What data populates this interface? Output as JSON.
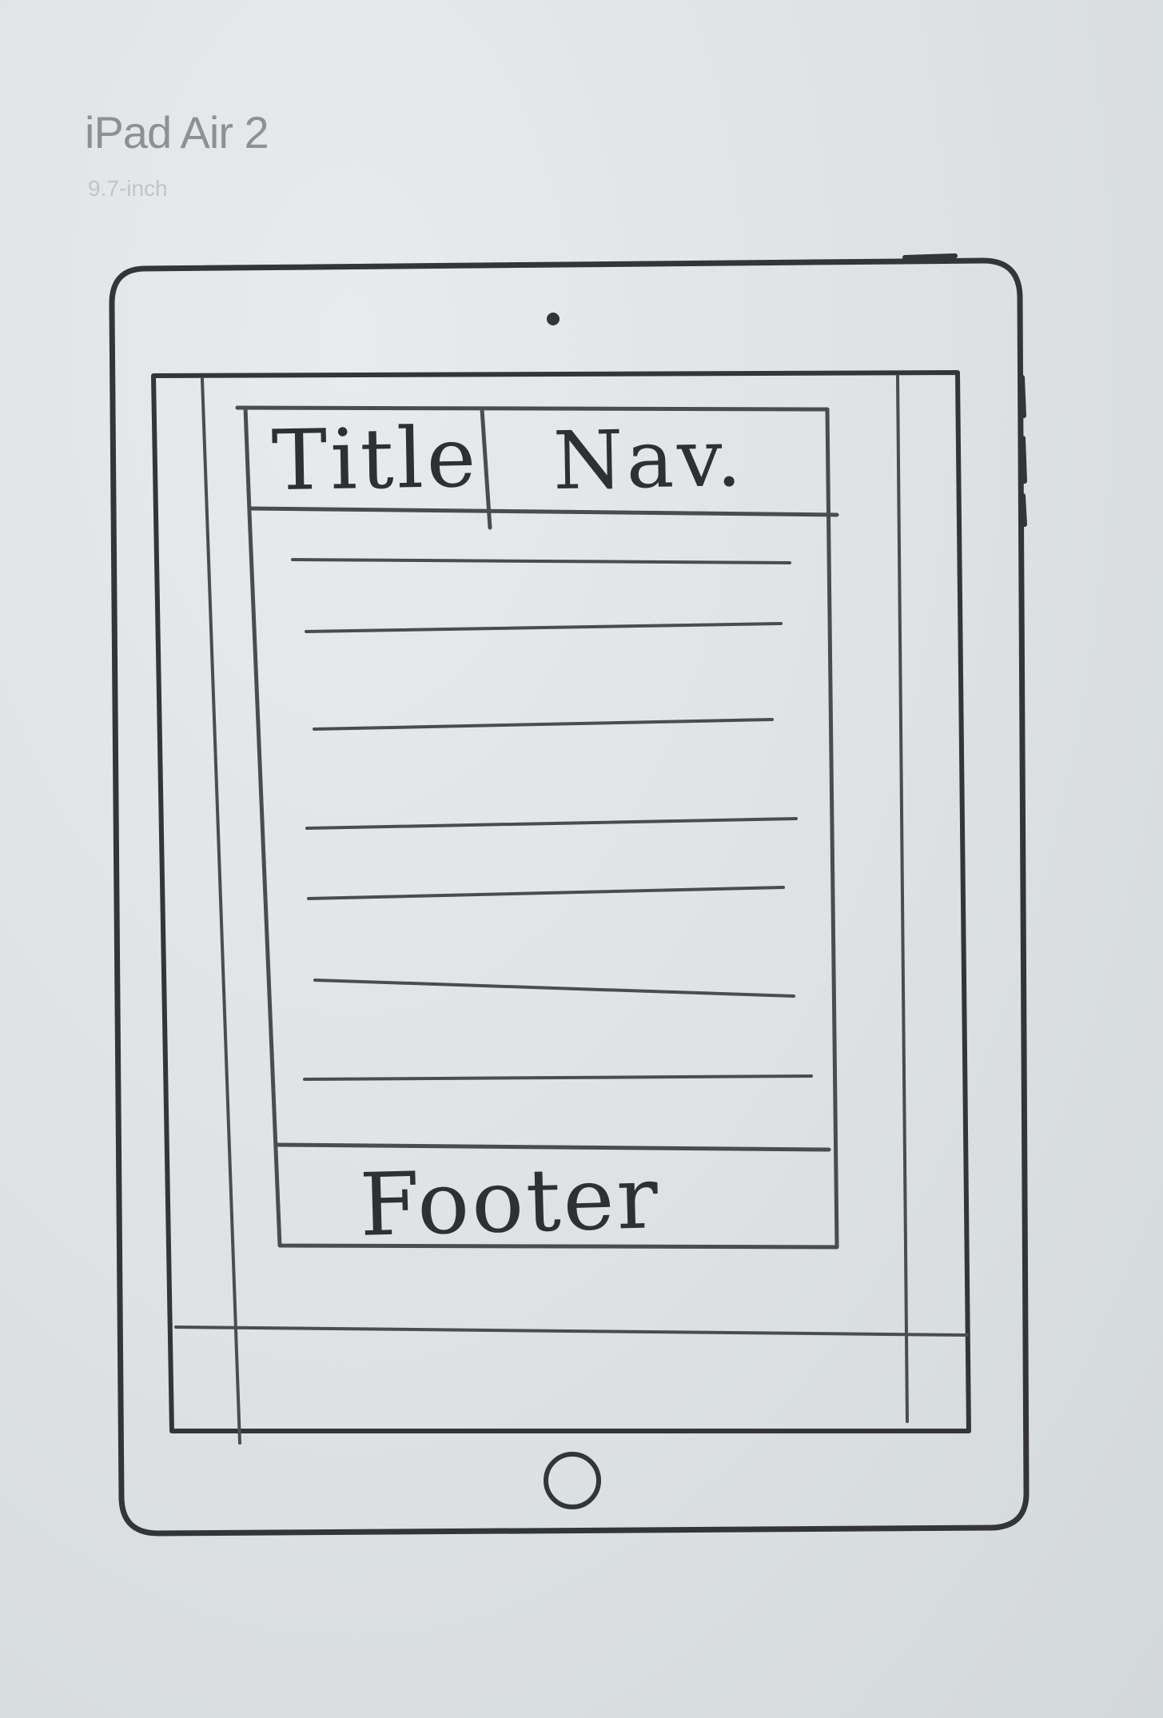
{
  "page": {
    "device_name": "iPad Air 2",
    "device_size": "9.7-inch"
  },
  "wireframe": {
    "header": {
      "title": "Title",
      "nav": "Nav."
    },
    "content_line_count": 7,
    "footer": {
      "label": "Footer"
    }
  },
  "colors": {
    "paper": "#dfe3e5",
    "ink": "#333537",
    "printed_heading": "#8e9194"
  }
}
